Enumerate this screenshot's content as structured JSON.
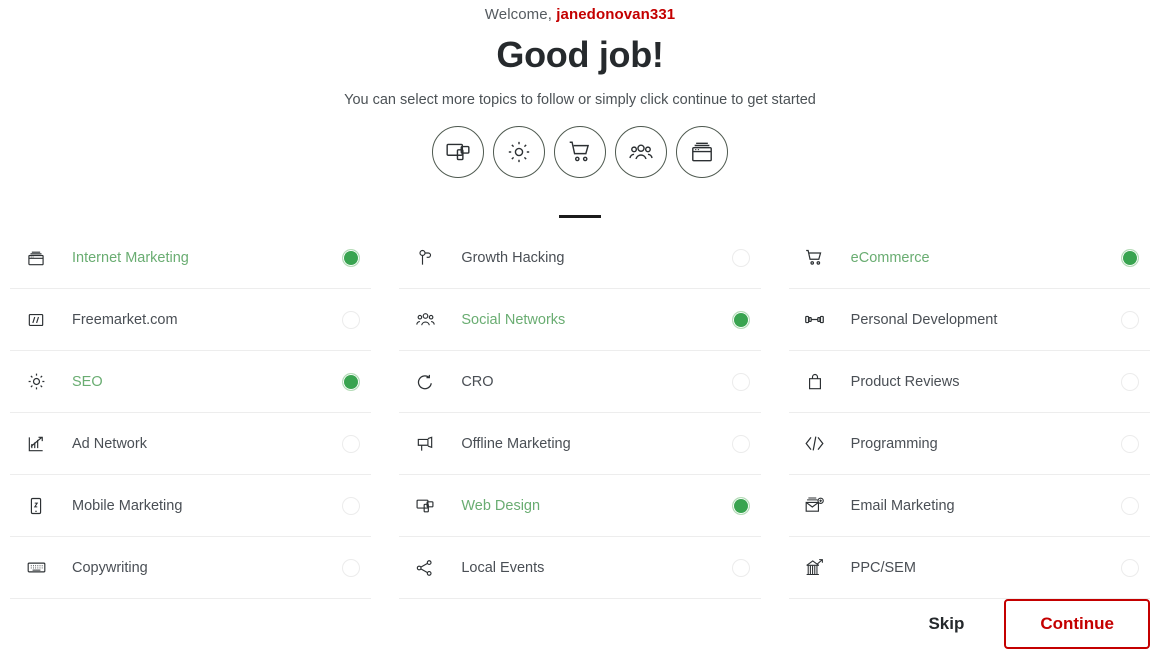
{
  "header": {
    "welcome_prefix": "Welcome, ",
    "username": "janedonovan331",
    "title": "Good job!",
    "subtitle": "You can select more topics to follow or simply click continue to get started"
  },
  "category_icons": [
    {
      "name": "devices-icon"
    },
    {
      "name": "gear-icon"
    },
    {
      "name": "shopping-cart-icon"
    },
    {
      "name": "people-group-icon"
    },
    {
      "name": "browser-window-icon"
    }
  ],
  "colors": {
    "accent_red": "#c40000",
    "selected_green": "#39a450",
    "label_green": "#6aad72",
    "label_gray": "#4a4f55",
    "row_border": "#ededed"
  },
  "columns": [
    {
      "topics": [
        {
          "label": "Internet Marketing",
          "icon": "browser-windows-icon",
          "selected": true
        },
        {
          "label": "Freemarket.com",
          "icon": "slash-box-icon",
          "selected": false
        },
        {
          "label": "SEO",
          "icon": "gear-icon",
          "selected": true
        },
        {
          "label": "Ad Network",
          "icon": "growth-chart-icon",
          "selected": false
        },
        {
          "label": "Mobile Marketing",
          "icon": "mobile-phone-icon",
          "selected": false
        },
        {
          "label": "Copywriting",
          "icon": "keyboard-icon",
          "selected": false
        }
      ]
    },
    {
      "topics": [
        {
          "label": "Growth Hacking",
          "icon": "flag-pin-icon",
          "selected": false
        },
        {
          "label": "Social Networks",
          "icon": "people-group-icon",
          "selected": true
        },
        {
          "label": "CRO",
          "icon": "refresh-cycle-icon",
          "selected": false
        },
        {
          "label": "Offline Marketing",
          "icon": "megaphone-icon",
          "selected": false
        },
        {
          "label": "Web Design",
          "icon": "devices-icon",
          "selected": true
        },
        {
          "label": "Local Events",
          "icon": "share-nodes-icon",
          "selected": false
        }
      ]
    },
    {
      "topics": [
        {
          "label": "eCommerce",
          "icon": "shopping-cart-icon",
          "selected": true
        },
        {
          "label": "Personal Development",
          "icon": "dumbbell-icon",
          "selected": false
        },
        {
          "label": "Product Reviews",
          "icon": "shopping-bag-icon",
          "selected": false
        },
        {
          "label": "Programming",
          "icon": "code-brackets-icon",
          "selected": false
        },
        {
          "label": "Email Marketing",
          "icon": "envelope-plus-icon",
          "selected": false
        },
        {
          "label": "PPC/SEM",
          "icon": "bar-chart-arrow-icon",
          "selected": false
        }
      ]
    }
  ],
  "footer": {
    "skip_label": "Skip",
    "continue_label": "Continue"
  }
}
